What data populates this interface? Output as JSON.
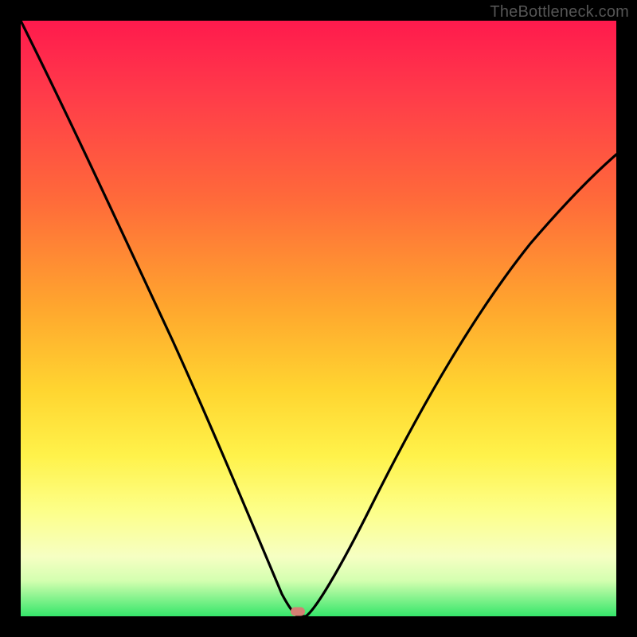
{
  "watermark": "TheBottleneck.com",
  "colors": {
    "frame": "#000000",
    "curve": "#000000",
    "marker": "#d48074",
    "gradient_top": "#ff1a4d",
    "gradient_bottom": "#35e66a"
  },
  "chart_data": {
    "type": "line",
    "title": "",
    "xlabel": "",
    "ylabel": "",
    "xlim": [
      0,
      100
    ],
    "ylim": [
      0,
      100
    ],
    "x": [
      0,
      3,
      6,
      10,
      14,
      18,
      22,
      26,
      30,
      34,
      36,
      38,
      40,
      42,
      44,
      46,
      50,
      55,
      60,
      65,
      70,
      75,
      80,
      85,
      90,
      95,
      100
    ],
    "values": [
      100,
      92,
      85,
      76,
      67,
      58,
      49,
      40,
      31,
      22,
      17,
      12,
      7,
      3,
      0.5,
      0,
      4,
      11,
      19,
      27,
      35,
      43,
      50,
      57,
      63,
      69,
      74
    ],
    "minimum_x": 46,
    "marker": {
      "x": 46,
      "y": 0
    },
    "grid": false,
    "legend": false
  }
}
